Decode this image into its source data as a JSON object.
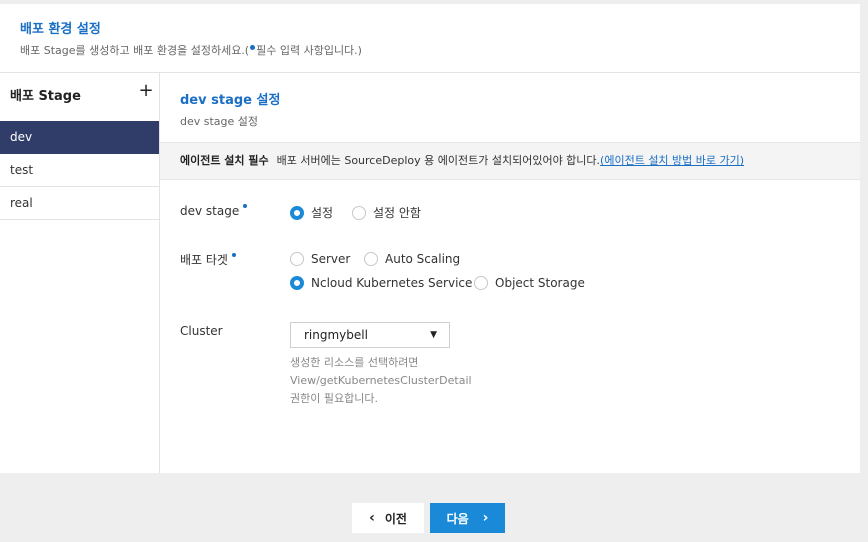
{
  "header": {
    "title": "배포 환경 설정",
    "desc_before": "배포 Stage를 생성하고 배포 환경을 설정하세요.(",
    "desc_after": "필수 입력 사항입니다.)"
  },
  "sidebar": {
    "title": "배포 Stage",
    "add_label": "+",
    "items": [
      {
        "label": "dev"
      },
      {
        "label": "test"
      },
      {
        "label": "real"
      }
    ]
  },
  "main": {
    "title": "dev stage 설정",
    "subtitle": "dev stage 설정"
  },
  "agent": {
    "label": "에이전트 설치 필수",
    "text": "배포 서버에는 SourceDeploy 용 에이전트가 설치되어있어야 합니다.",
    "link": "(에이전트 설치 방법 바로 가기)"
  },
  "form": {
    "stage_label": "dev stage",
    "stage_options": [
      {
        "label": "설정",
        "checked": true
      },
      {
        "label": "설정 안함",
        "checked": false
      }
    ],
    "target_label": "배포 타겟",
    "target_options": [
      {
        "label": "Server",
        "checked": false
      },
      {
        "label": "Auto Scaling",
        "checked": false
      },
      {
        "label": "Ncloud Kubernetes Service",
        "checked": true
      },
      {
        "label": "Object Storage",
        "checked": false
      }
    ],
    "cluster_label": "Cluster",
    "cluster_value": "ringmybell",
    "cluster_arrow": "▼",
    "help_lines": [
      "생성한 리소스를 선택하려면",
      "View/getKubernetesClusterDetail",
      "권한이 필요합니다."
    ]
  },
  "footer": {
    "prev_label": "이전",
    "next_label": "다음",
    "prev_icon": "‹",
    "next_icon": "›"
  },
  "colors": {
    "accent": "#1a6fc4",
    "radio": "#1a8ad8",
    "sidebar_active": "#2f3d68"
  }
}
